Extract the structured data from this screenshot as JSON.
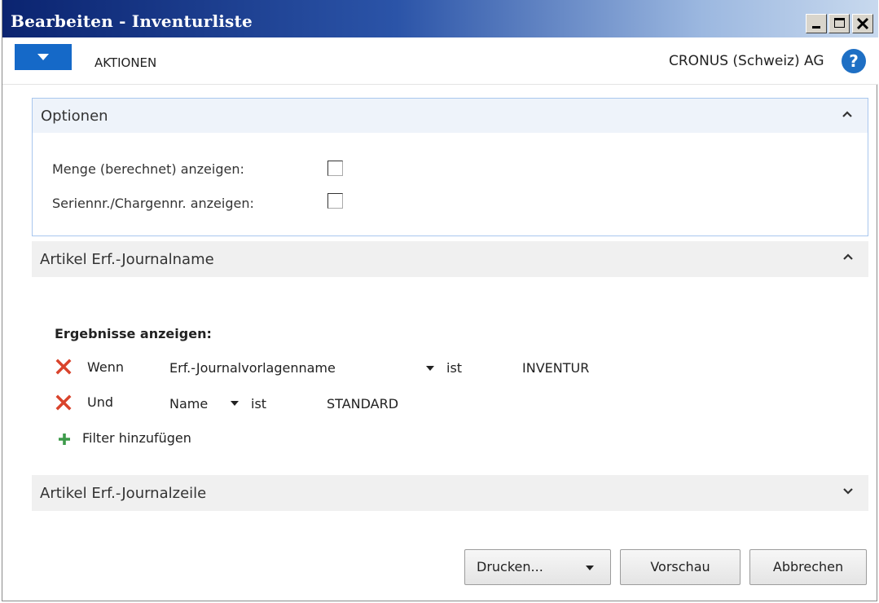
{
  "window": {
    "title": "Bearbeiten - Inventurliste"
  },
  "actionbar": {
    "actions_label": "AKTIONEN",
    "company": "CRONUS (Schweiz) AG",
    "help_glyph": "?"
  },
  "options": {
    "title": "Optionen",
    "rows": [
      {
        "label": "Menge (berechnet) anzeigen:",
        "checked": false
      },
      {
        "label": "Seriennr./Chargennr. anzeigen:",
        "checked": false
      }
    ]
  },
  "journal_name": {
    "title": "Artikel Erf.-Journalname",
    "filters_heading": "Ergebnisse anzeigen:",
    "filters": [
      {
        "conjunction": "Wenn",
        "field": "Erf.-Journalvorlagenname",
        "operator": "ist",
        "value": "INVENTUR"
      },
      {
        "conjunction": "Und",
        "field": "Name",
        "operator": "ist",
        "value": "STANDARD"
      }
    ],
    "add_filter_label": "Filter hinzufügen"
  },
  "journal_line": {
    "title": "Artikel Erf.-Journalzeile"
  },
  "buttons": {
    "print": "Drucken...",
    "preview": "Vorschau",
    "cancel": "Abbrechen"
  },
  "colors": {
    "accent": "#1569c8",
    "remove_filter": "#d9432b",
    "add_filter": "#3d9a4a"
  },
  "icons": [
    "menu-caret-icon",
    "help-icon",
    "chevron-up-icon",
    "chevron-down-icon",
    "remove-filter-icon",
    "add-filter-icon",
    "dropdown-caret-icon"
  ]
}
